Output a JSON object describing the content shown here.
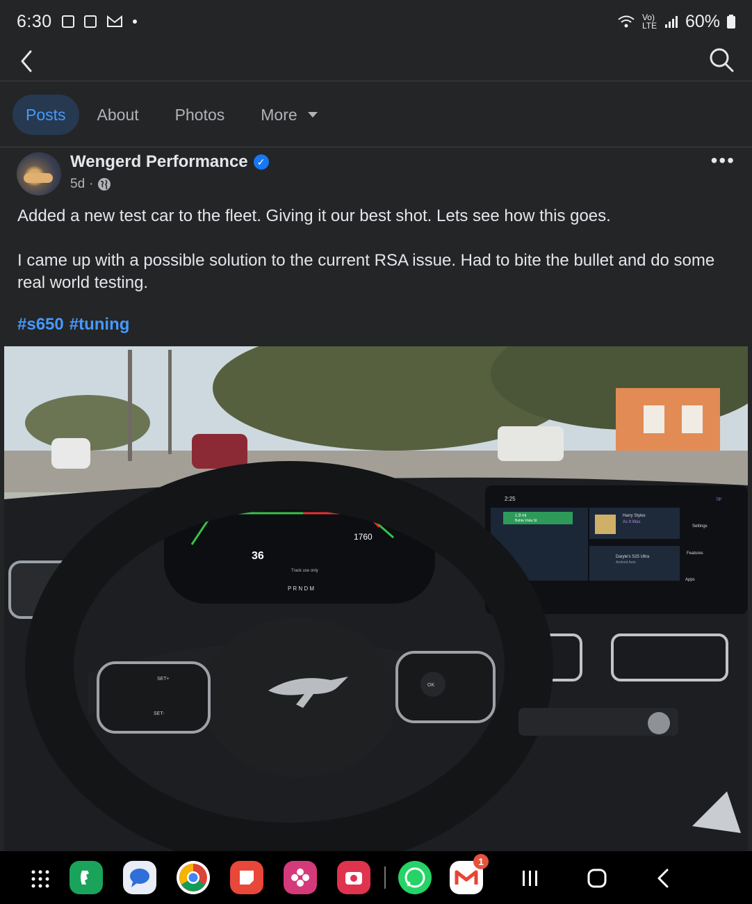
{
  "status_bar": {
    "time": "6:30",
    "battery": "60%",
    "network": "Vo) LTE"
  },
  "tabs": [
    {
      "label": "Posts",
      "active": true
    },
    {
      "label": "About",
      "active": false
    },
    {
      "label": "Photos",
      "active": false
    },
    {
      "label": "More",
      "active": false
    }
  ],
  "post": {
    "author": "Wengerd Performance",
    "verified": true,
    "time": "5d",
    "separator": "·",
    "paragraph1": "Added a new test car to the fleet. Giving it our best shot. Lets see how this goes.",
    "paragraph2": "I came up with a possible solution to the current RSA issue. Had to bite the bullet and do some real world testing.",
    "hashtags": [
      "#s650",
      "#tuning"
    ],
    "more_label": "•••"
  },
  "photo": {
    "cluster_rpm": "1760",
    "cluster_speed": "36",
    "gear_indicator": "P R N D M",
    "screen_time": "2:25",
    "nav_distance": "1.9 mi",
    "nav_street": "Bahia Vista St",
    "media_artist": "Harry Styles",
    "media_title": "As It Was",
    "device_name": "Daryle's S25 Ultra",
    "device_sub": "Android Auto",
    "menu_settings": "Settings",
    "menu_features": "Features",
    "menu_apps": "Apps",
    "track_label": "Track use only",
    "temp": "78°",
    "button_set_plus": "SET+",
    "button_set_minus": "SET-",
    "button_ok": "OK"
  },
  "navbar": {
    "gmail_badge": "1"
  },
  "colors": {
    "accent": "#4599ff",
    "tab_active_bg": "#263951",
    "background": "#242526",
    "verified": "#1877f2"
  }
}
